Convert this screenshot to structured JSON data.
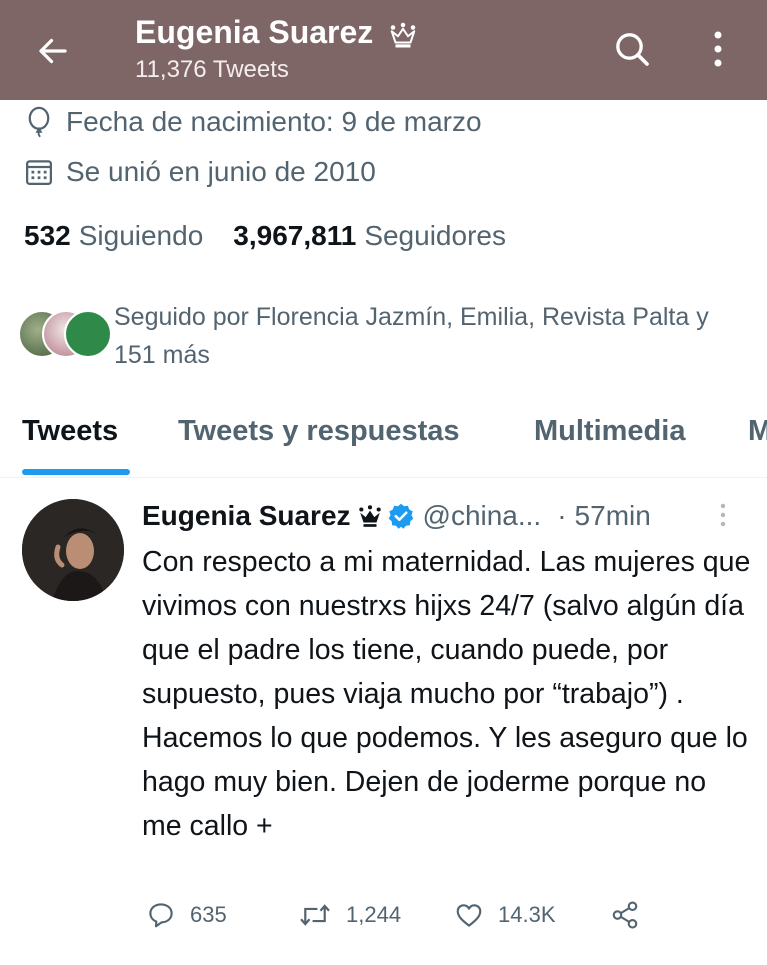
{
  "header": {
    "name": "Eugenia Suarez",
    "tweet_count": "11,376 Tweets",
    "bar_color": "#7f6666"
  },
  "profile": {
    "birthdate": "Fecha de nacimiento: 9 de marzo",
    "joined": "Se unió en junio de 2010",
    "following_count": "532",
    "following_label": "Siguiendo",
    "followers_count": "3,967,811",
    "followers_label": "Seguidores",
    "followed_by": "Seguido por Florencia Jazmín, Emilia, Revista Palta y 151 más"
  },
  "tabs": [
    {
      "label": "Tweets",
      "active": true
    },
    {
      "label": "Tweets y respuestas",
      "active": false
    },
    {
      "label": "Multimedia",
      "active": false
    },
    {
      "label": "M",
      "active": false
    }
  ],
  "tweet": {
    "name": "Eugenia Suarez",
    "handle": "@china...",
    "separator": "·",
    "time": "57min",
    "text": "Con respecto a mi maternidad. Las mujeres que vivimos con nuestrxs hijxs 24/7 (salvo algún día que el padre los tiene, cuando puede, por supuesto, pues viaja mucho por “trabajo”) . Hacemos lo que podemos. Y les aseguro que lo hago muy bien. Dejen de joderme porque no me callo +",
    "replies": "635",
    "retweets": "1,244",
    "likes": "14.3K"
  },
  "colors": {
    "accent": "#1d9bf0",
    "secondary_text": "#536471"
  }
}
